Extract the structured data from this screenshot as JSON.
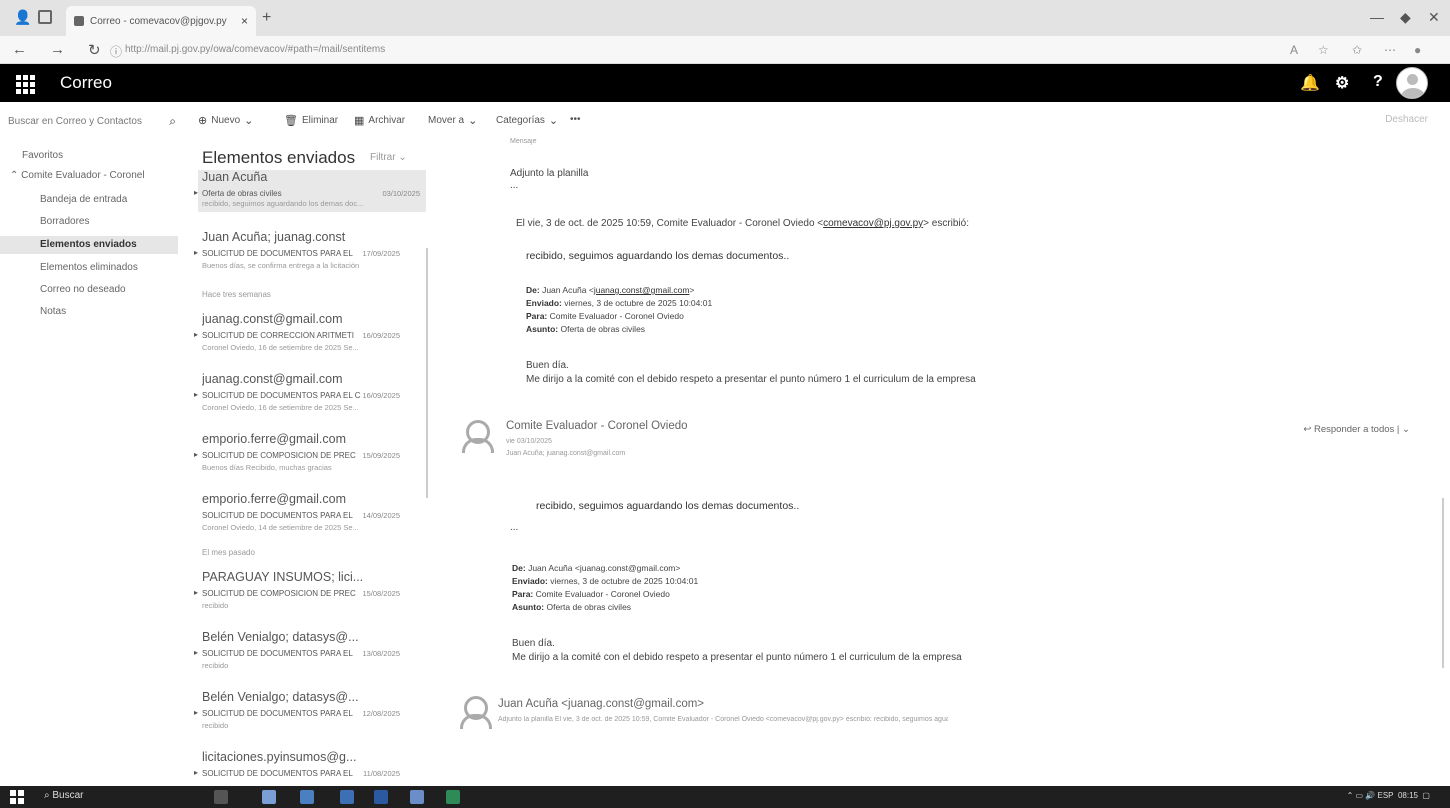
{
  "browser": {
    "tab_title": "Correo - comevacov@pjgov.py",
    "tab_close": "×",
    "new_tab": "+",
    "url": "http://mail.pj.gov.py/owa/comevacov/#path=/mail/sentitems",
    "url_host": "mail.pj.gov.py"
  },
  "app": {
    "name": "Correo",
    "bell": "🔔",
    "gear": "⚙",
    "help": "?"
  },
  "toolbar": {
    "search_placeholder": "Buscar en Correo y Contactos",
    "nuevo": "Nuevo",
    "eliminar": "Eliminar",
    "archivar": "Archivar",
    "mover": "Mover a",
    "categorias": "Categorías",
    "more": "•••",
    "deshacer": "Deshacer"
  },
  "folders": {
    "favoritos": "Favoritos",
    "group": "Comite Evaluador - Coronel",
    "items": [
      "Bandeja de entrada",
      "Borradores",
      "Elementos enviados",
      "Elementos eliminados",
      "Correo no deseado",
      "Notas"
    ]
  },
  "list": {
    "title": "Elementos enviados",
    "filter": "Filtrar",
    "sep_three_weeks": "Hace tres semanas",
    "sep_last_month": "El mes pasado",
    "messages": [
      {
        "from": "Juan Acuña",
        "subject": "Oferta de obras civiles",
        "date": "03/10/2025",
        "preview": "recibido, seguimos aguardando los demas doc..."
      },
      {
        "from": "Juan Acuña; juanag.const",
        "subject": "SOLICITUD DE DOCUMENTOS PARA EL",
        "date": "17/09/2025",
        "preview": "Buenos días, se confirma entrega a la licitación"
      },
      {
        "from": "juanag.const@gmail.com",
        "subject": "SOLICITUD DE CORRECCION ARITMETI",
        "date": "16/09/2025",
        "preview": "Coronel Oviedo, 16 de setiembre de 2025 Se..."
      },
      {
        "from": "juanag.const@gmail.com",
        "subject": "SOLICITUD DE DOCUMENTOS PARA EL C",
        "date": "16/09/2025",
        "preview": "Coronel Oviedo, 16 de setiembre de 2025 Se..."
      },
      {
        "from": "emporio.ferre@gmail.com",
        "subject": "SOLICITUD DE COMPOSICION DE PREC",
        "date": "15/09/2025",
        "preview": "Buenos días Recibido, muchas gracias"
      },
      {
        "from": "emporio.ferre@gmail.com",
        "subject": "SOLICITUD DE DOCUMENTOS PARA EL",
        "date": "14/09/2025",
        "preview": "Coronel Oviedo, 14 de setiembre de 2025 Se..."
      },
      {
        "from": "PARAGUAY INSUMOS; lici...",
        "subject": "SOLICITUD DE COMPOSICION DE PREC",
        "date": "15/08/2025",
        "preview": "recibido"
      },
      {
        "from": "Belén Venialgo; datasys@...",
        "subject": "SOLICITUD DE DOCUMENTOS PARA EL",
        "date": "13/08/2025",
        "preview": "recibido"
      },
      {
        "from": "Belén Venialgo; datasys@...",
        "subject": "SOLICITUD DE DOCUMENTOS PARA EL",
        "date": "12/08/2025",
        "preview": "recibido"
      },
      {
        "from": "licitaciones.pyinsumos@g...",
        "subject": "SOLICITUD DE DOCUMENTOS PARA EL",
        "date": "11/08/2025",
        "preview": ""
      }
    ]
  },
  "reading": {
    "top_meta": "Mensaje",
    "adjunto": "Adjunto la planilla",
    "dots": "...",
    "quote_intro": "El vie, 3 de oct. de 2025 10:59, Comite Evaluador - Coronel Oviedo <",
    "quote_email": "comevacov@pj.gov.py",
    "quote_outro": "> escribió:",
    "recibido": "recibido, seguimos aguardando los demas documentos..",
    "de_label": "De:",
    "de_value": "Juan Acuña <",
    "de_email": "juanag.const@gmail.com",
    "de_close": ">",
    "de_full": "Juan Acuña <juanag.const@gmail.com>",
    "enviado_label": "Enviado:",
    "enviado_value": "viernes, 3 de octubre de 2025 10:04:01",
    "para_label": "Para:",
    "para_value": "Comite Evaluador - Coronel Oviedo",
    "asunto_label": "Asunto:",
    "asunto_value": "Oferta de obras civiles",
    "buen_dia": "Buen día.",
    "body_line": "Me dirijo a la comité con el debido respeto a presentar el punto número 1 el curriculum de la empresa",
    "sender2": "Comite Evaluador - Coronel Oviedo",
    "sender2_date": "vie 03/10/2025",
    "sender2_to": "Juan Acuña; juanag.const@gmail.com",
    "reply_all": "Responder a todos",
    "sender3": "Juan Acuña <juanag.const@gmail.com>",
    "sender3_preview": "Adjunto la planilla El vie, 3 de oct. de 2025 10:59, Comite Evaluador - Coronel Oviedo <comevacov@pj.gov.py> escribió: recibido, seguimos aguardando..."
  },
  "taskbar": {
    "search": "Buscar",
    "lang": "ESP",
    "time": "08:15"
  },
  "colors": {
    "appbar": "#000000",
    "selected": "#e6e6e6",
    "taskbar": "#1f1f1f"
  }
}
